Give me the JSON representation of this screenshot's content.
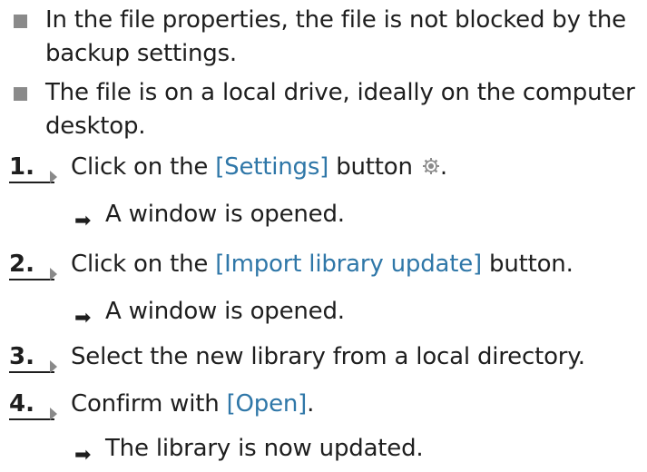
{
  "colors": {
    "text": "#1e1e1e",
    "ui_reference": "#2f77a8",
    "bullet_marker": "#8a8a8a",
    "step_arrow": "#8a8a8a"
  },
  "prerequisites": [
    {
      "text": "In the file properties, the file is not blocked by the backup settings."
    },
    {
      "text": "The file is on a local drive, ideally on the computer desktop."
    }
  ],
  "steps": [
    {
      "number": "1.",
      "before": "Click on the ",
      "ui_element": "[Settings]",
      "after": " button",
      "icon": "settings-gear-icon",
      "end": ".",
      "result": "A window is opened."
    },
    {
      "number": "2.",
      "before": "Click on the ",
      "ui_element": "[Import library update]",
      "after": " button.",
      "result": "A window is opened."
    },
    {
      "number": "3.",
      "text": "Select the new library from a local directory."
    },
    {
      "number": "4.",
      "before": "Confirm with ",
      "ui_element": "[Open]",
      "after": ".",
      "result": "The library is now updated."
    }
  ],
  "result_arrow_glyph": "➡"
}
